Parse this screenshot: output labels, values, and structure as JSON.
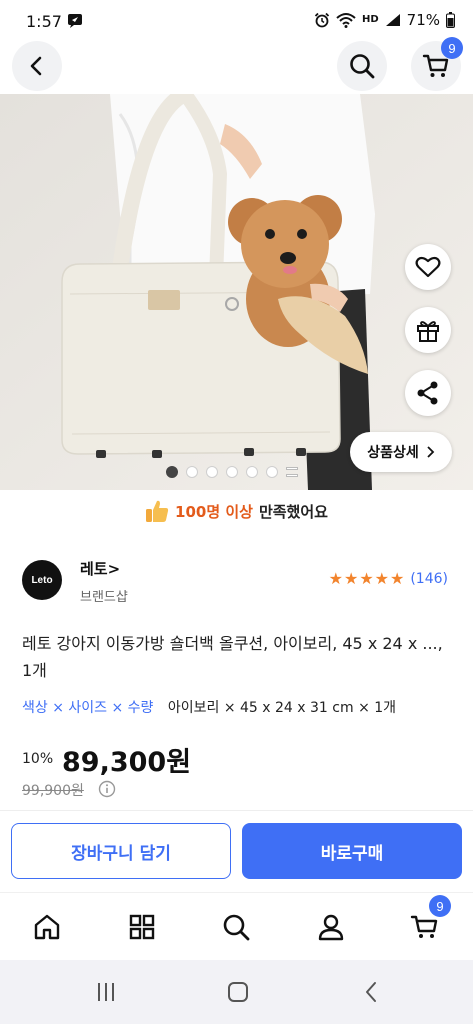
{
  "status": {
    "time": "1:57",
    "network": "HD",
    "battery": "71%"
  },
  "nav": {
    "cart_count": "9"
  },
  "gallery": {
    "detail_button": "상품상세",
    "page_count": 6,
    "current_index": 0
  },
  "satisfaction": {
    "highlight": "100명 이상",
    "rest": "만족했어요"
  },
  "brand": {
    "logo_text": "Leto",
    "name": "레토>",
    "subtitle": "브랜드샵"
  },
  "rating": {
    "stars": 5,
    "count": "(146)"
  },
  "product": {
    "title": "레토 강아지 이동가방 숄더백 올쿠션, 아이보리, 45 x 24 x ..., 1개",
    "option_label": "색상 × 사이즈 × 수량",
    "option_value": "아이보리 × 45 x 24 x 31 cm × 1개",
    "discount": "10%",
    "price": "89,300원",
    "original_price": "99,900원"
  },
  "actions": {
    "add_to_cart": "장바구니 담기",
    "buy_now": "바로구매"
  },
  "tabbar": {
    "cart_count": "9"
  },
  "colors": {
    "accent": "#3f6ff5",
    "star": "#f2842d",
    "satisfaction_highlight": "#e35b1b"
  }
}
